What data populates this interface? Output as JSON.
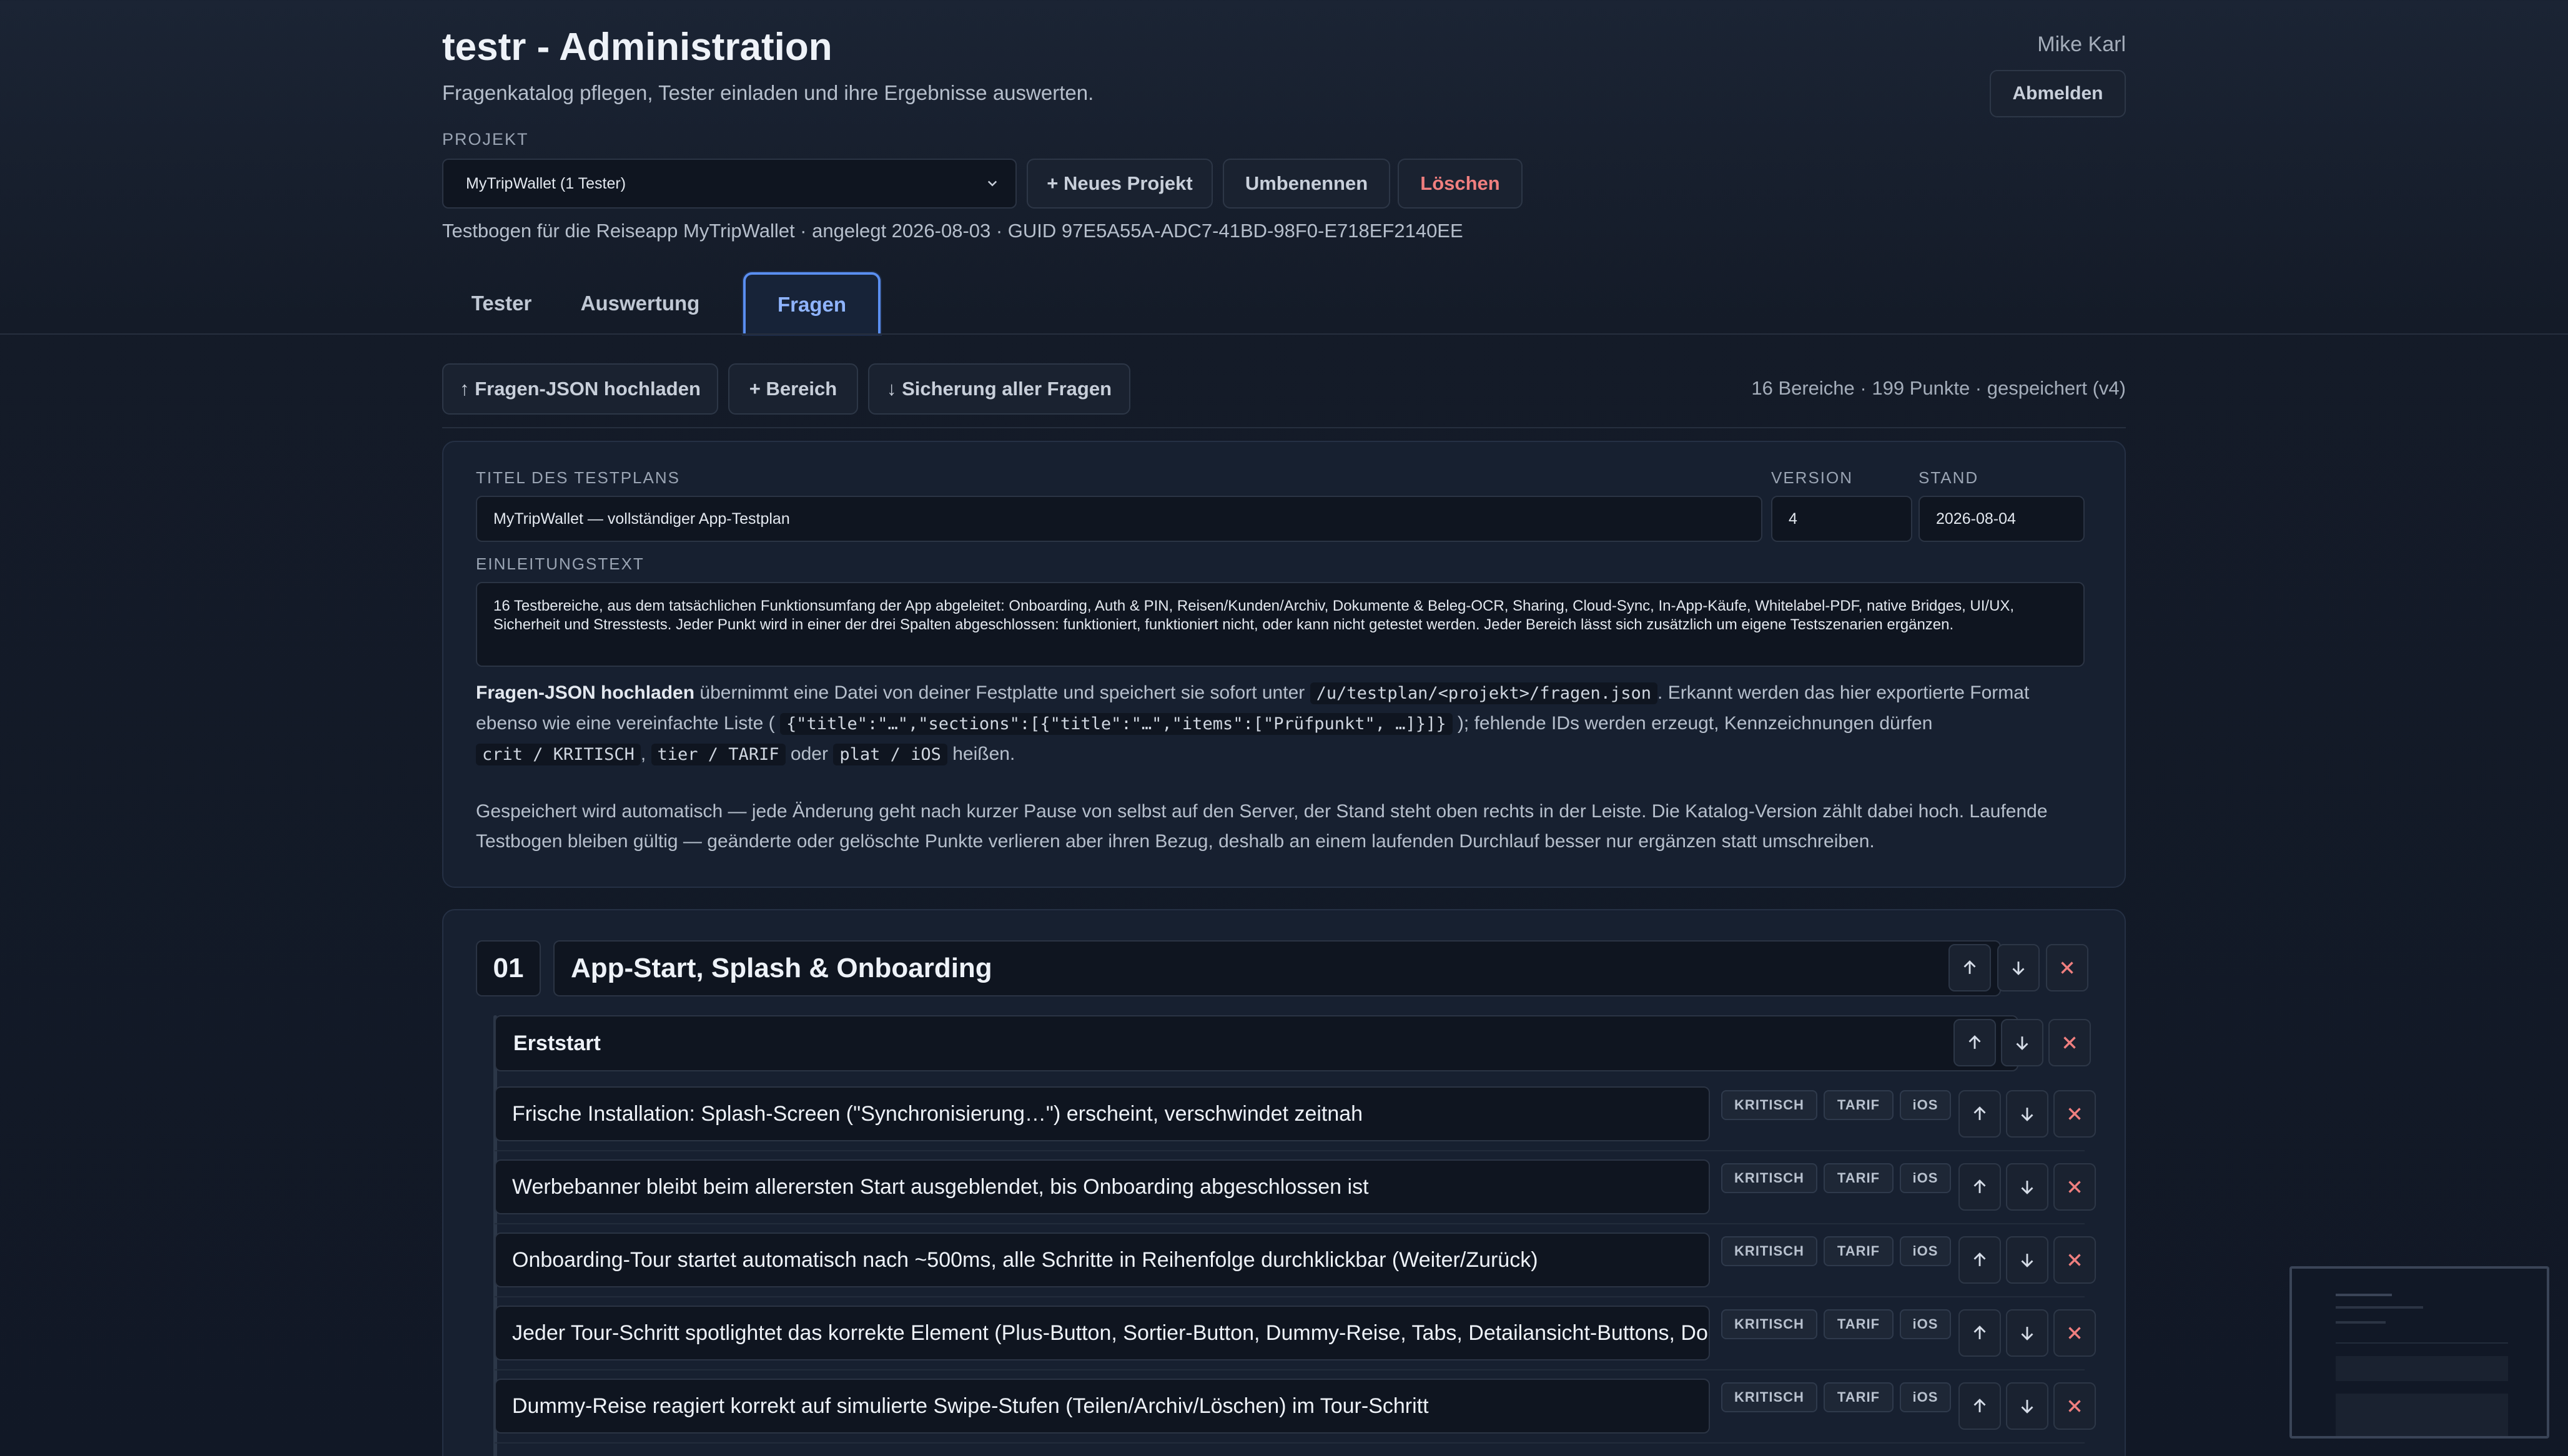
{
  "header": {
    "title": "testr - Administration",
    "subtitle": "Fragenkatalog pflegen, Tester einladen und ihre Ergebnisse auswerten.",
    "user": "Mike Karl",
    "logout_label": "Abmelden"
  },
  "project": {
    "label": "PROJEKT",
    "selected": "MyTripWallet (1 Tester)",
    "new_label": "+ Neues Projekt",
    "rename_label": "Umbenennen",
    "delete_label": "Löschen",
    "meta": "Testbogen für die Reiseapp MyTripWallet · angelegt 2026-08-03 · GUID 97E5A55A-ADC7-41BD-98F0-E718EF2140EE"
  },
  "tabs": [
    {
      "label": "Tester",
      "active": false
    },
    {
      "label": "Auswertung",
      "active": false
    },
    {
      "label": "Fragen",
      "active": true
    }
  ],
  "toolbar": {
    "upload_label": "↑ Fragen-JSON hochladen",
    "add_section_label": "+ Bereich",
    "backup_label": "↓ Sicherung aller Fragen",
    "status": "16 Bereiche · 199 Punkte · gespeichert (v4)"
  },
  "plan": {
    "title_label": "TITEL DES TESTPLANS",
    "title_value": "MyTripWallet — vollständiger App-Testplan",
    "version_label": "VERSION",
    "version_value": "4",
    "stand_label": "STAND",
    "stand_value": "2026-08-04",
    "intro_label": "EINLEITUNGSTEXT",
    "intro_value": "16 Testbereiche, aus dem tatsächlichen Funktionsumfang der App abgeleitet: Onboarding, Auth & PIN, Reisen/Kunden/Archiv, Dokumente & Beleg-OCR, Sharing, Cloud-Sync, In-App-Käufe, Whitelabel-PDF, native Bridges, UI/UX, Sicherheit und Stresstests. Jeder Punkt wird in einer der drei Spalten abgeschlossen: funktioniert, funktioniert nicht, oder kann nicht getestet werden. Jeder Bereich lässt sich zusätzlich um eigene Testszenarien ergänzen.",
    "help1_bold": "Fragen-JSON hochladen",
    "help1_a": " übernimmt eine Datei von deiner Festplatte und speichert sie sofort unter ",
    "help1_code_path": "/u/testplan/<projekt>/fragen.json",
    "help1_b": ". Erkannt werden das hier exportierte Format",
    "help1_c": "ebenso wie eine vereinfachte Liste ( ",
    "help1_code_json": "{\"title\":\"…\",\"sections\":[{\"title\":\"…\",\"items\":[\"Prüfpunkt\", …]}]}",
    "help1_d": " ); fehlende IDs werden erzeugt, Kennzeichnungen dürfen",
    "help1_code_crit": "crit / KRITISCH",
    "help1_code_tier": "tier / TARIF",
    "help1_or": " oder ",
    "help1_code_plat": "plat / iOS",
    "help1_end": " heißen.",
    "help2": "Gespeichert wird automatisch — jede Änderung geht nach kurzer Pause von selbst auf den Server, der Stand steht oben rechts in der Leiste. Die Katalog-Version zählt dabei hoch. Laufende Testbogen bleiben gültig — geänderte oder gelöschte Punkte verlieren aber ihren Bezug, deshalb an einem laufenden Durchlauf besser nur ergänzen statt umschreiben."
  },
  "section": {
    "number": "01",
    "title": "App-Start, Splash & Onboarding",
    "group_title": "Erststart",
    "tags": {
      "crit": "KRITISCH",
      "tier": "TARIF",
      "plat": "iOS"
    },
    "items": [
      "Frische Installation: Splash-Screen (\"Synchronisierung…\") erscheint, verschwindet zeitnah",
      "Werbebanner bleibt beim allerersten Start ausgeblendet, bis Onboarding abgeschlossen ist",
      "Onboarding-Tour startet automatisch nach ~500ms, alle Schritte in Reihenfolge durchklickbar (Weiter/Zurück)",
      "Jeder Tour-Schritt spotlightet das korrekte Element (Plus-Button, Sortier-Button, Dummy-Reise, Tabs, Detailansicht-Buttons, Dokumente)",
      "Dummy-Reise reagiert korrekt auf simulierte Swipe-Stufen (Teilen/Archiv/Löschen) im Tour-Schritt"
    ]
  },
  "colors": {
    "accent": "#5a8ef0",
    "danger": "#f07f7f",
    "background": "#141b28"
  }
}
